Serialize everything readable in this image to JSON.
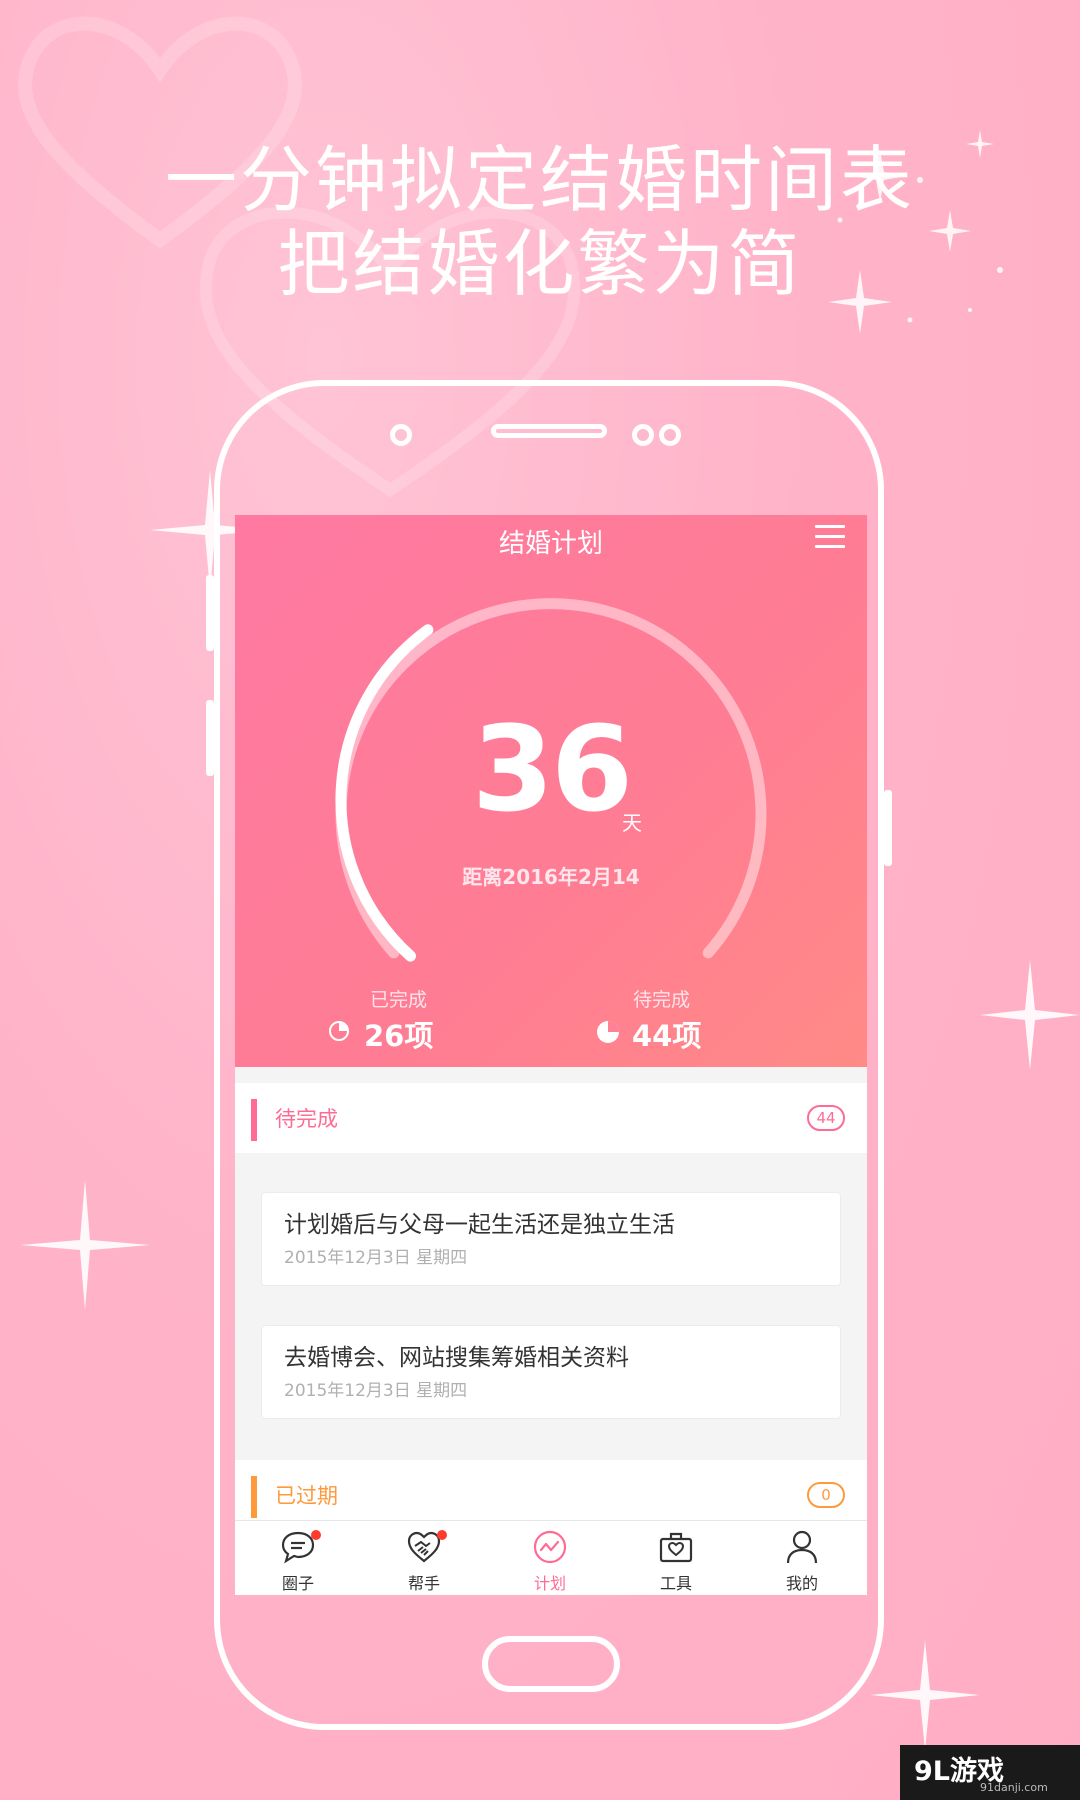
{
  "promo": {
    "headline_line1": "一分钟拟定结婚时间表",
    "headline_line2": "把结婚化繁为简"
  },
  "app": {
    "title": "结婚计划",
    "menu_icon": "hamburger-menu-icon"
  },
  "countdown": {
    "days": "36",
    "unit": "天",
    "target_label": "距离2016年2月14",
    "ring_progress": 0.37
  },
  "stats": {
    "completed": {
      "label": "已完成",
      "value": "26项",
      "icon": "pie-chart-icon"
    },
    "pending": {
      "label": "待完成",
      "value": "44项",
      "icon": "pie-chart-icon"
    }
  },
  "sections": {
    "pending": {
      "title": "待完成",
      "count": "44",
      "accent": "#ff6b94"
    },
    "overdue": {
      "title": "已过期",
      "count": "0",
      "accent": "#ff9a3c"
    }
  },
  "tasks": [
    {
      "title": "计划婚后与父母一起生活还是独立生活",
      "date": "2015年12月3日   星期四"
    },
    {
      "title": "去婚博会、网站搜集筹婚相关资料",
      "date": "2015年12月3日   星期四"
    }
  ],
  "tabs": [
    {
      "label": "圈子",
      "icon": "chat-bubble-icon",
      "badge": true,
      "active": false
    },
    {
      "label": "帮手",
      "icon": "handshake-heart-icon",
      "badge": true,
      "active": false
    },
    {
      "label": "计划",
      "icon": "trend-circle-icon",
      "badge": false,
      "active": true
    },
    {
      "label": "工具",
      "icon": "toolbox-icon",
      "badge": false,
      "active": false
    },
    {
      "label": "我的",
      "icon": "person-icon",
      "badge": false,
      "active": false
    }
  ],
  "colors": {
    "background": "#ffb3c9",
    "hero_start": "#ff79a2",
    "hero_end": "#ff8a86",
    "active_tab": "#ff6b94"
  },
  "watermark": {
    "text": "9L游戏",
    "sub": "91danji.com"
  }
}
